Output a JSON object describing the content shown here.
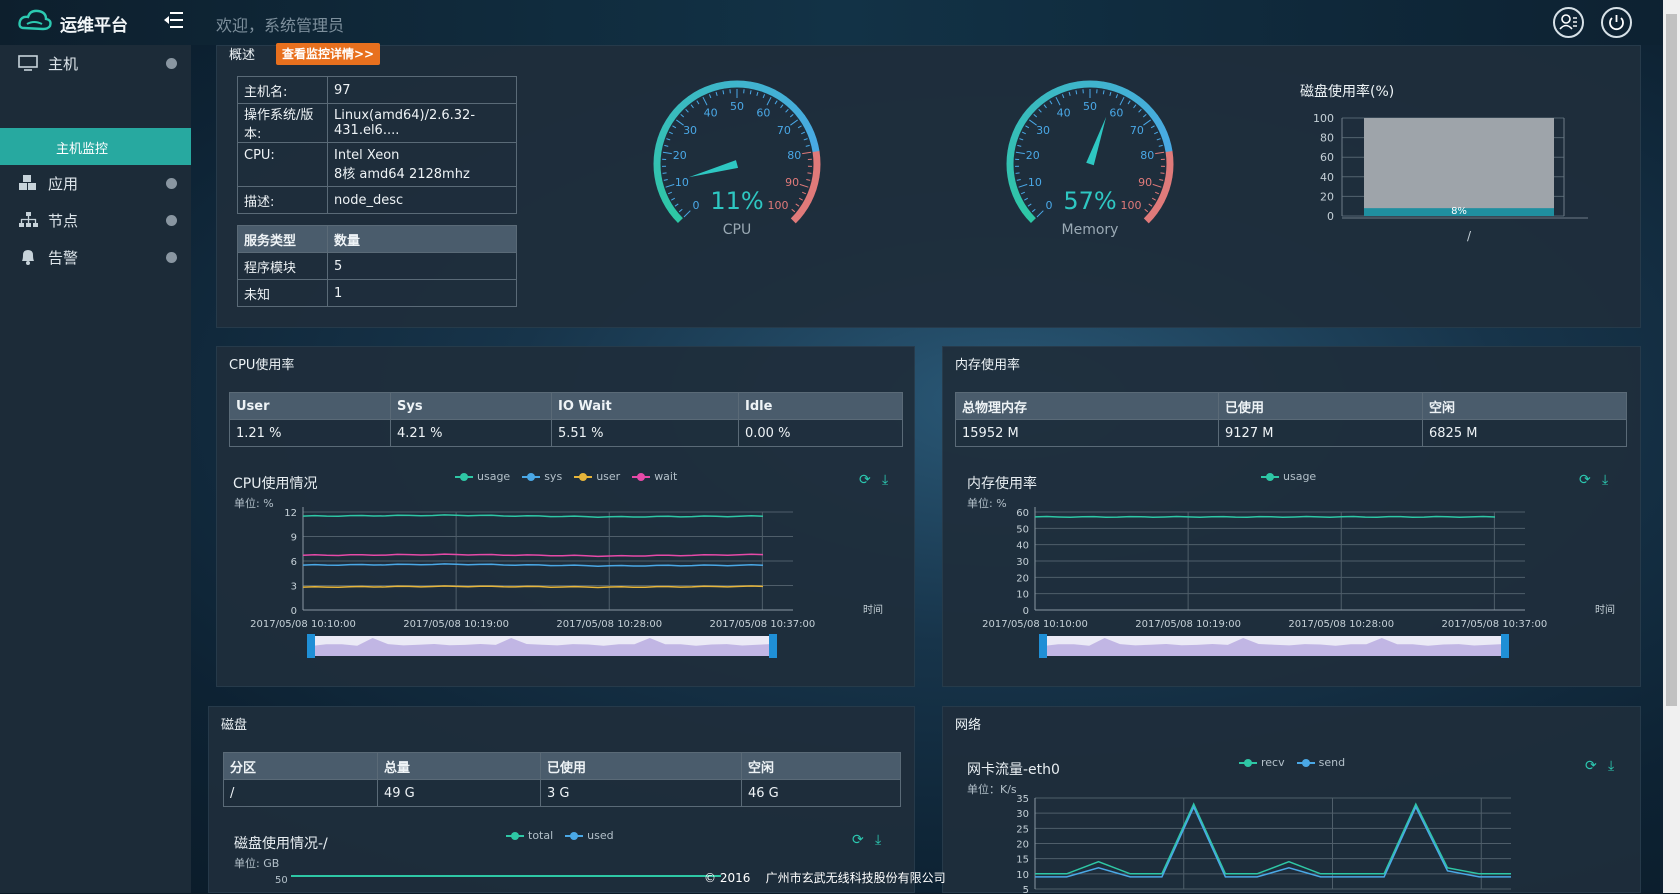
{
  "app": {
    "title": "运维平台",
    "welcome": "欢迎，系统管理员"
  },
  "sidebar": {
    "items": [
      {
        "label": "主机",
        "icon": "monitor-icon"
      },
      {
        "label": "应用",
        "icon": "cubes-icon"
      },
      {
        "label": "节点",
        "icon": "sitemap-icon"
      },
      {
        "label": "告警",
        "icon": "bell-icon"
      }
    ],
    "sub_active": "主机监控"
  },
  "overview": {
    "title": "概述",
    "detail_button": "查看监控详情>>",
    "host_rows": [
      {
        "k": "主机名:",
        "v": "97"
      },
      {
        "k": "操作系统/版本:",
        "v": "Linux(amd64)/2.6.32-431.el6...."
      },
      {
        "k": "CPU:",
        "v": "Intel Xeon",
        "v2": "8核 amd64 2128mhz"
      },
      {
        "k": "描述:",
        "v": "node_desc"
      }
    ],
    "service_header": {
      "type": "服务类型",
      "count": "数量"
    },
    "service_rows": [
      {
        "type": "程序模块",
        "count": "5"
      },
      {
        "type": "未知",
        "count": "1"
      }
    ],
    "cpu_gauge": {
      "value": 11,
      "value_label": "11%",
      "label": "CPU",
      "ticks": [
        "0",
        "10",
        "20",
        "30",
        "40",
        "50",
        "60",
        "70",
        "80",
        "90",
        "100"
      ]
    },
    "mem_gauge": {
      "value": 57,
      "value_label": "57%",
      "label": "Memory",
      "ticks": [
        "0",
        "10",
        "20",
        "30",
        "40",
        "50",
        "60",
        "70",
        "80",
        "90",
        "100"
      ]
    },
    "disk_usage": {
      "title": "磁盘使用率(%)",
      "yticks": [
        "100",
        "80",
        "60",
        "40",
        "20",
        "0"
      ],
      "category": "/",
      "value": 8,
      "value_label": "8%"
    }
  },
  "cpu_panel": {
    "title": "CPU使用率",
    "headers": [
      "User",
      "Sys",
      "IO Wait",
      "Idle"
    ],
    "values": [
      "1.21 %",
      "4.21 %",
      "5.51 %",
      "0.00 %"
    ],
    "chart_title": "CPU使用情况",
    "unit": "单位: %",
    "legend": [
      "usage",
      "sys",
      "user",
      "wait"
    ],
    "xaxis_name": "时间",
    "yticks": [
      "12",
      "9",
      "6",
      "3",
      "0"
    ],
    "xticks": [
      "2017/05/08 10:10:00",
      "2017/05/08 10:19:00",
      "2017/05/08 10:28:00",
      "2017/05/08 10:37:00"
    ]
  },
  "mem_panel": {
    "title": "内存使用率",
    "headers": [
      "总物理内存",
      "已使用",
      "空闲"
    ],
    "values": [
      "15952 M",
      "9127 M",
      "6825 M"
    ],
    "chart_title": "内存使用率",
    "unit": "单位: %",
    "legend": [
      "usage"
    ],
    "xaxis_name": "时间",
    "yticks": [
      "60",
      "50",
      "40",
      "30",
      "20",
      "10",
      "0"
    ],
    "xticks": [
      "2017/05/08 10:10:00",
      "2017/05/08 10:19:00",
      "2017/05/08 10:28:00",
      "2017/05/08 10:37:00"
    ]
  },
  "disk_panel": {
    "title": "磁盘",
    "headers": [
      "分区",
      "总量",
      "已使用",
      "空闲"
    ],
    "values": [
      "/",
      "49 G",
      "3 G",
      "46 G"
    ],
    "chart_title": "磁盘使用情况-/",
    "unit": "单位: GB",
    "legend": [
      "total",
      "used"
    ],
    "ytick_top": "50"
  },
  "net_panel": {
    "title": "网络",
    "chart_title": "网卡流量-eth0",
    "unit": "单位：K/s",
    "legend": [
      "recv",
      "send"
    ],
    "yticks": [
      "35",
      "30",
      "25",
      "20",
      "15",
      "10",
      "5"
    ]
  },
  "footer": "© 2016    广州市玄武无线科技股份有限公司",
  "colors": {
    "usage": "#2ec7a5",
    "sys": "#4aa8e6",
    "user": "#e6b53a",
    "wait": "#e64aa8",
    "accent": "#27a9a0",
    "orange": "#e8701e"
  },
  "chart_data": [
    {
      "type": "line",
      "title": "CPU使用情况",
      "ylabel": "单位: %",
      "xlabel": "时间",
      "ylim": [
        0,
        12
      ],
      "x": [
        "2017/05/08 10:10:00",
        "2017/05/08 10:19:00",
        "2017/05/08 10:28:00",
        "2017/05/08 10:37:00"
      ],
      "series": [
        {
          "name": "usage",
          "values": [
            11.5,
            11.6,
            11.4,
            11.5
          ]
        },
        {
          "name": "sys",
          "values": [
            5.5,
            5.6,
            5.4,
            5.5
          ]
        },
        {
          "name": "user",
          "values": [
            2.8,
            2.9,
            2.8,
            2.9
          ]
        },
        {
          "name": "wait",
          "values": [
            6.7,
            6.8,
            6.6,
            6.8
          ]
        }
      ]
    },
    {
      "type": "line",
      "title": "内存使用率",
      "ylabel": "单位: %",
      "xlabel": "时间",
      "ylim": [
        0,
        60
      ],
      "x": [
        "2017/05/08 10:10:00",
        "2017/05/08 10:19:00",
        "2017/05/08 10:28:00",
        "2017/05/08 10:37:00"
      ],
      "series": [
        {
          "name": "usage",
          "values": [
            57,
            57,
            57,
            57
          ]
        }
      ]
    },
    {
      "type": "bar",
      "title": "磁盘使用率(%)",
      "categories": [
        "/"
      ],
      "values": [
        8
      ],
      "ylim": [
        0,
        100
      ]
    },
    {
      "type": "line",
      "title": "网卡流量-eth0",
      "ylabel": "单位：K/s",
      "ylim": [
        5,
        35
      ],
      "series": [
        {
          "name": "recv",
          "values": [
            10,
            10,
            14,
            10,
            10,
            33,
            10,
            10,
            14,
            10,
            10,
            10,
            33,
            12,
            10,
            10
          ]
        },
        {
          "name": "send",
          "values": [
            9,
            9,
            12,
            9,
            9,
            32,
            9,
            9,
            12,
            9,
            9,
            9,
            32,
            11,
            9,
            9
          ]
        }
      ]
    }
  ]
}
